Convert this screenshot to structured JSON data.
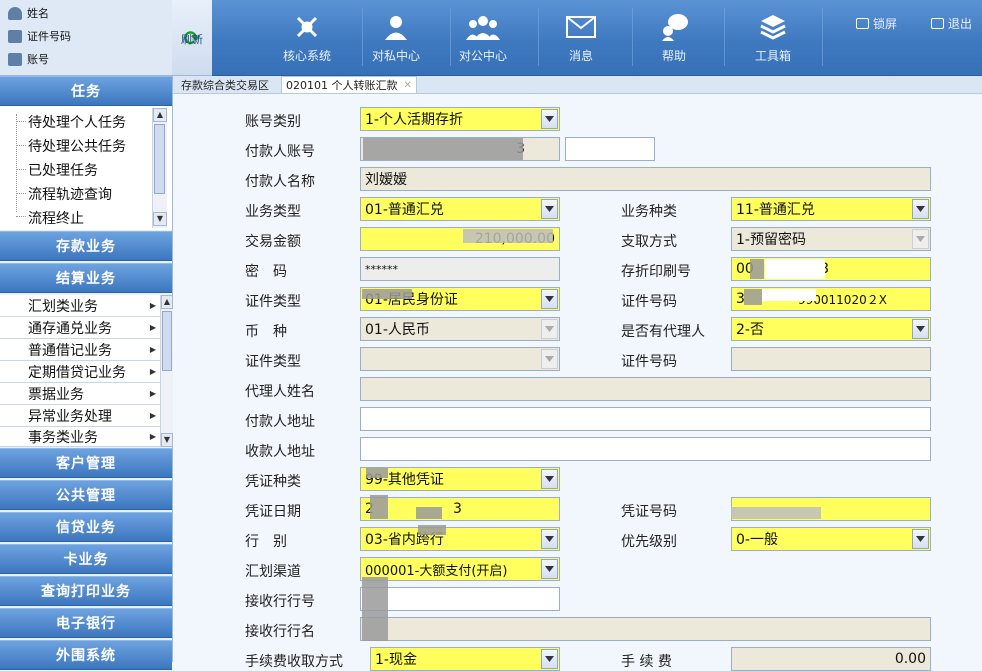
{
  "user": {
    "name_label": "姓名",
    "id_label": "证件号码",
    "account_label": "账号"
  },
  "refresh_label": "刷新",
  "nav": {
    "items": [
      {
        "label": "核心系统",
        "icon": "network-icon"
      },
      {
        "label": "对私中心",
        "icon": "person-icon"
      },
      {
        "label": "对公中心",
        "icon": "group-icon"
      },
      {
        "label": "消息",
        "icon": "envelope-icon"
      },
      {
        "label": "帮助",
        "icon": "help-icon"
      },
      {
        "label": "工具箱",
        "icon": "toolbox-icon"
      }
    ],
    "lock_label": "锁屏",
    "logout_label": "退出"
  },
  "sidebar": {
    "task_header": "任务",
    "tasks": [
      "待处理个人任务",
      "待处理公共任务",
      "已处理任务",
      "流程轨迹查询",
      "流程终止"
    ],
    "sections_mid": [
      "存款业务",
      "结算业务"
    ],
    "settlement_items": [
      "汇划类业务",
      "通存通兑业务",
      "普通借记业务",
      "定期借贷记业务",
      "票据业务",
      "异常业务处理",
      "事务类业务"
    ],
    "sections_bottom": [
      "客户管理",
      "公共管理",
      "信贷业务",
      "卡业务",
      "查询打印业务",
      "电子银行",
      "外围系统"
    ]
  },
  "tabs": [
    {
      "label": "存款综合类交易区"
    },
    {
      "label": "020101 个人转账汇款"
    }
  ],
  "form": {
    "account_type_label": "账号类别",
    "account_type_value": "1-个人活期存折",
    "payer_account_label": "付款人账号",
    "payer_account_value": "3",
    "payer_name_label": "付款人名称",
    "payer_name_value": "刘嫒嫒",
    "biz_type_label": "业务类型",
    "biz_type_value": "01-普通汇兑",
    "biz_kind_label": "业务种类",
    "biz_kind_value": "11-普通汇兑",
    "amount_label": "交易金额",
    "amount_value": "210,000.00",
    "withdraw_label": "支取方式",
    "withdraw_value": "1-预留密码",
    "pwd_label": "密　码",
    "pwd_value": "******",
    "print_no_label": "存折印刷号",
    "print_no_value": "00",
    "print_no_tail": "8",
    "id_type_label": "证件类型",
    "id_type_value": "01-居民身份证",
    "id_no_label": "证件号码",
    "id_no_value": "3",
    "id_no_tail": "990011020２X",
    "currency_label": "币　种",
    "currency_value": "01-人民币",
    "agent_label": "是否有代理人",
    "agent_value": "2-否",
    "agent_id_type_label": "证件类型",
    "agent_id_no_label": "证件号码",
    "agent_name_label": "代理人姓名",
    "payer_addr_label": "付款人地址",
    "payee_addr_label": "收款人地址",
    "voucher_type_label": "凭证种类",
    "voucher_type_value": "99-其他凭证",
    "voucher_date_label": "凭证日期",
    "voucher_date_value": "2",
    "voucher_date_tail": "3",
    "voucher_no_label": "凭证号码",
    "bank_type_label": "行　别",
    "bank_type_value": "03-省内跨行",
    "priority_label": "优先级别",
    "priority_value": "0-一般",
    "channel_label": "汇划渠道",
    "channel_value": "000001-大额支付(开启)",
    "recv_bank_no_label": "接收行行号",
    "recv_bank_name_label": "接收行行名",
    "fee_mode_label": "手续费收取方式",
    "fee_mode_value": "1-现金",
    "fee_label": "手 续 费",
    "fee_value": "0.00"
  },
  "colors": {
    "required_field": "#ffff5e",
    "readonly_field": "#ece9da",
    "nav_blue": "#3f79c0"
  }
}
